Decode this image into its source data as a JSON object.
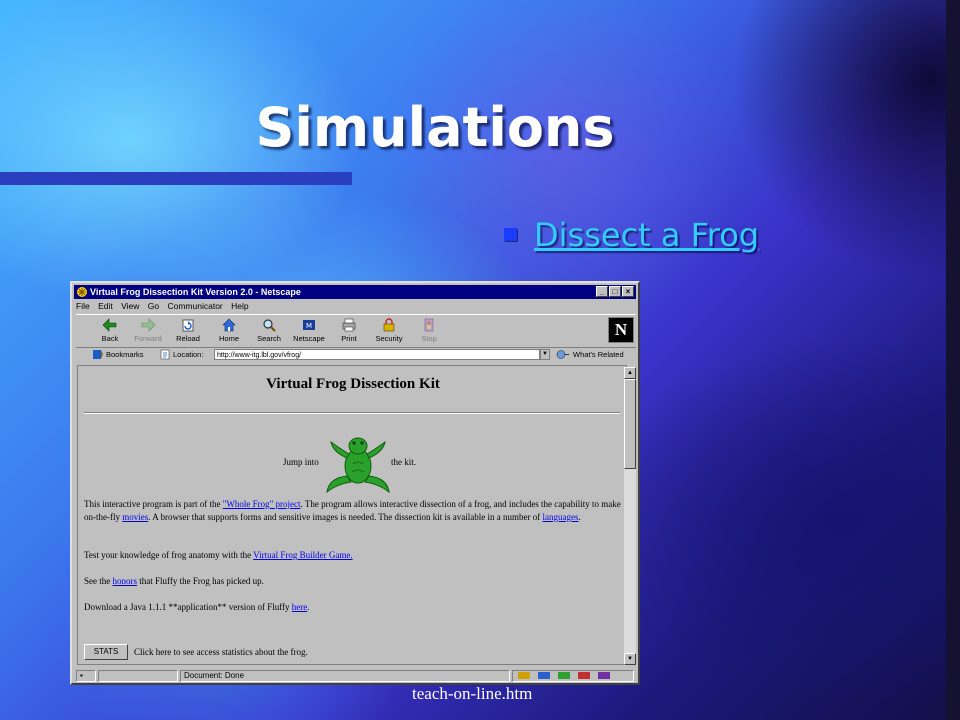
{
  "slide": {
    "title": "Simulations",
    "bullet_link": "Dissect a Frog",
    "footer": "teach-on-line.htm"
  },
  "browser": {
    "window_title": "Virtual Frog Dissection Kit Version 2.0 - Netscape",
    "menu": [
      "File",
      "Edit",
      "View",
      "Go",
      "Communicator",
      "Help"
    ],
    "toolbar": [
      {
        "label": "Back",
        "icon": "back-arrow-icon"
      },
      {
        "label": "Forward",
        "icon": "forward-arrow-icon"
      },
      {
        "label": "Reload",
        "icon": "reload-icon"
      },
      {
        "label": "Home",
        "icon": "home-icon"
      },
      {
        "label": "Search",
        "icon": "search-icon"
      },
      {
        "label": "Netscape",
        "icon": "netscape-icon"
      },
      {
        "label": "Print",
        "icon": "print-icon"
      },
      {
        "label": "Security",
        "icon": "lock-icon"
      },
      {
        "label": "Stop",
        "icon": "stop-icon"
      }
    ],
    "bookmarks_label": "Bookmarks",
    "location_label": "Location:",
    "location_url": "http://www-itg.lbl.gov/vfrog/",
    "whats_related": "What's Related",
    "status_text": "Document: Done"
  },
  "page": {
    "heading": "Virtual Frog Dissection Kit",
    "jump_pre": "Jump into",
    "jump_post": "the kit.",
    "p1": {
      "t1": "This interactive program is part of the ",
      "l1": "\"Whole Frog\" project",
      "t2": ". The program allows interactive dissection of a frog, and includes the capability to make on-the-fly ",
      "l2": "movies",
      "t3": ". A browser that supports forms and sensitive images is needed. The dissection kit is available in a number of ",
      "l3": "languages",
      "t4": "."
    },
    "p2": {
      "t1": "Test your knowledge of frog anatomy with the ",
      "l1": "Virtual Frog Builder Game."
    },
    "p3": {
      "t1": "See the ",
      "l1": "honors",
      "t2": " that Fluffy the Frog has picked up."
    },
    "p4": {
      "t1": "Download a Java 1.1.1 **application** version of Fluffy ",
      "l1": "here",
      "t2": "."
    },
    "stats_button": "STATS",
    "stats_text": "Click here to see access statistics about the frog."
  },
  "colors": {
    "title_bar": "#000080",
    "link": "#0000ee",
    "bullet": "#1a3cff",
    "bullet_link": "#33ccff"
  }
}
